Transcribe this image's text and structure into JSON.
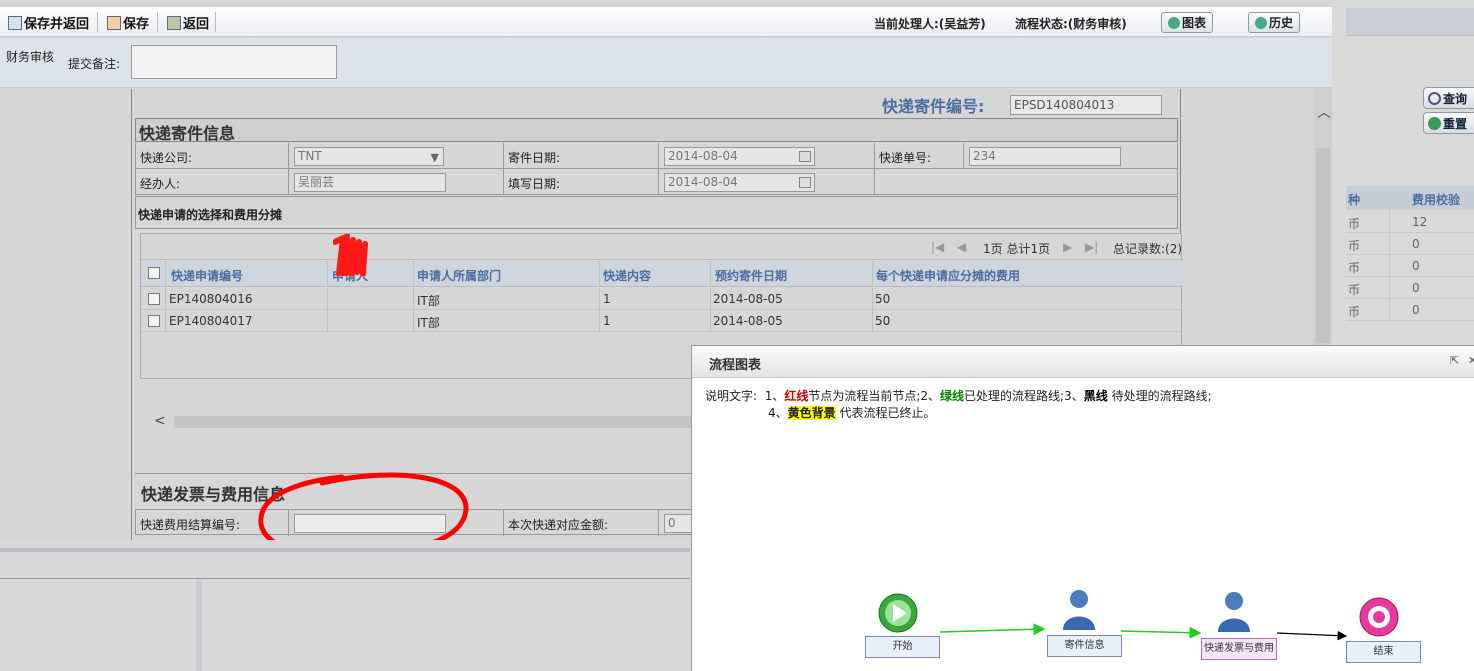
{
  "toolbar": {
    "save_return": "保存并返回",
    "save": "保存",
    "back": "返回",
    "handler": "当前处理人:(吴益芳)",
    "status": "流程状态:(财务审核)",
    "chart_btn": "图表",
    "history_btn": "历史"
  },
  "remark": {
    "stage": "财务审核",
    "label": "提交备注:",
    "value": ""
  },
  "form": {
    "code_label": "快递寄件编号:",
    "code_value": "EPSD140804013",
    "section1_title": "快递寄件信息",
    "courier_label": "快递公司:",
    "courier_value": "TNT",
    "send_date_label": "寄件日期:",
    "send_date_value": "2014-08-04",
    "tracking_label": "快递单号:",
    "tracking_value": "234",
    "handler_label": "经办人:",
    "handler_value": "吴丽芸",
    "fill_date_label": "填写日期:",
    "fill_date_value": "2014-08-04",
    "subsection_title": "快递申请的选择和费用分摊",
    "section2_title": "快递发票与费用信息",
    "settle_label": "快递费用结算编号:",
    "settle_value": "",
    "amount_label": "本次快递对应金额:",
    "amount_value": "0"
  },
  "grid": {
    "pager_text": "1页 总计1页",
    "total_text": "总记录数:(2)",
    "columns": [
      "快递申请编号",
      "申请人",
      "申请人所属部门",
      "快递内容",
      "预约寄件日期",
      "每个快递申请应分摊的费用"
    ],
    "rows": [
      {
        "id": "EP140804016",
        "dept": "IT部",
        "content": "1",
        "date": "2014-08-05",
        "fee": "50"
      },
      {
        "id": "EP140804017",
        "dept": "IT部",
        "content": "1",
        "date": "2014-08-05",
        "fee": "50"
      }
    ]
  },
  "right_panel": {
    "query_btn": "查询",
    "reset_btn": "重置",
    "col1": "种",
    "col2": "费用校验",
    "rows": [
      {
        "a": "币",
        "b": "12"
      },
      {
        "a": "币",
        "b": "0"
      },
      {
        "a": "币",
        "b": "0"
      },
      {
        "a": "币",
        "b": "0"
      },
      {
        "a": "币",
        "b": "0"
      }
    ]
  },
  "dialog": {
    "title": "流程图表",
    "legend_prefix": "说明文字:",
    "legend_1a": "1、",
    "legend_red": "红线",
    "legend_1b": "节点为流程当前节点;2、",
    "legend_green": "绿线",
    "legend_2b": "已处理的流程路线;3、",
    "legend_black": "黑线",
    "legend_3b": " 待处理的流程路线;",
    "legend_4a": "4、",
    "legend_yellow": "黄色背景",
    "legend_4b": " 代表流程已终止。",
    "nodes": [
      "开始",
      "寄件信息",
      "快递发票与费用",
      "结束"
    ]
  },
  "colors": {
    "accent_blue": "#4a6fa0",
    "done_line": "#22cc22",
    "pending_line": "#000000",
    "annotation_red": "#ff0000"
  }
}
